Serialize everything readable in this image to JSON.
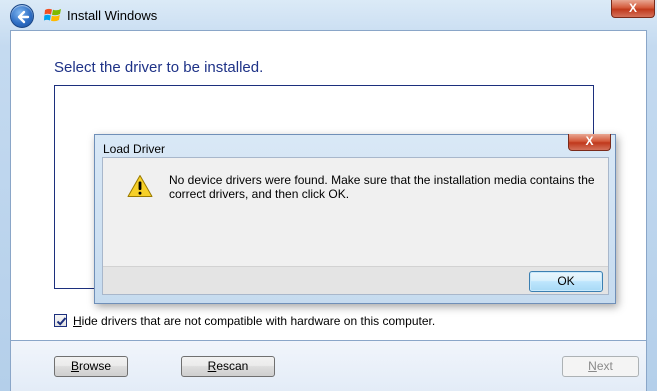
{
  "window": {
    "title": "Install Windows",
    "close_glyph": "X"
  },
  "main": {
    "heading": "Select the driver to be installed.",
    "hide_checkbox": {
      "checked": true,
      "label_u": "H",
      "label_rest": "ide drivers that are not compatible with hardware on this computer."
    }
  },
  "buttons": {
    "browse_u": "B",
    "browse_rest": "rowse",
    "rescan_u": "R",
    "rescan_rest": "escan",
    "next_u": "N",
    "next_rest": "ext"
  },
  "dialog": {
    "title": "Load Driver",
    "close_glyph": "X",
    "message": "No device drivers were found. Make sure that the installation media contains the correct drivers, and then click OK.",
    "ok_label": "OK"
  },
  "icons": {
    "back": "back-arrow-icon",
    "app": "windows-logo-icon",
    "warning": "warning-icon",
    "checkmark": "checkmark-icon"
  },
  "colors": {
    "heading": "#1e3287",
    "close_button": "#c0391c",
    "ok_button_border": "#3c7fb1"
  }
}
